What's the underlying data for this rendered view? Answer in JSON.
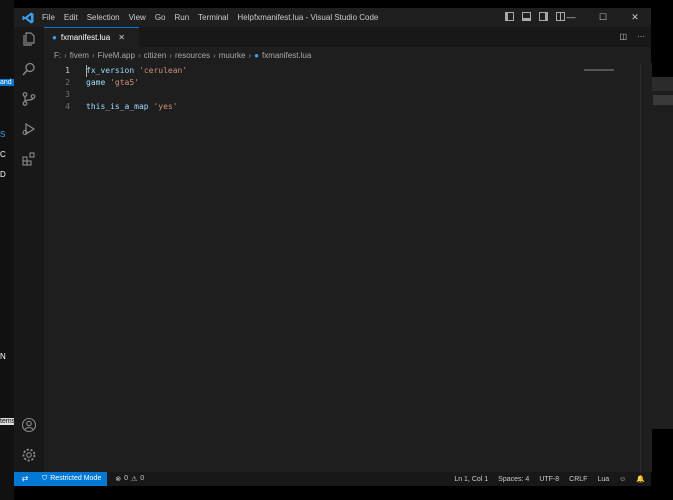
{
  "window": {
    "title": "fxmanifest.lua - Visual Studio Code",
    "menu": [
      "File",
      "Edit",
      "Selection",
      "View",
      "Go",
      "Run",
      "Terminal",
      "Help"
    ]
  },
  "tab": {
    "name": "fxmanifest.lua"
  },
  "breadcrumb": [
    "F:",
    "fivem",
    "FiveM.app",
    "citizen",
    "resources",
    "muurke",
    "fxmanifest.lua"
  ],
  "editor": {
    "lines": [
      {
        "num": "1",
        "keyword": "fx_version",
        "string": "'cerulean'"
      },
      {
        "num": "2",
        "keyword": "game",
        "string": "'gta5'"
      },
      {
        "num": "3",
        "keyword": "",
        "string": ""
      },
      {
        "num": "4",
        "keyword": "this_is_a_map",
        "string": "'yes'"
      }
    ]
  },
  "statusbar": {
    "restricted": "Restricted Mode",
    "errors": "0",
    "warnings": "0",
    "position": "Ln 1, Col 1",
    "spaces": "Spaces: 4",
    "encoding": "UTF-8",
    "eol": "CRLF",
    "language": "Lua"
  },
  "background": {
    "left_fragments": [
      "and",
      "S",
      "C",
      "D",
      "N",
      "tems"
    ]
  },
  "colors": {
    "accent": "#0078d4",
    "string": "#ce9178",
    "identifier": "#9cdcfe"
  }
}
